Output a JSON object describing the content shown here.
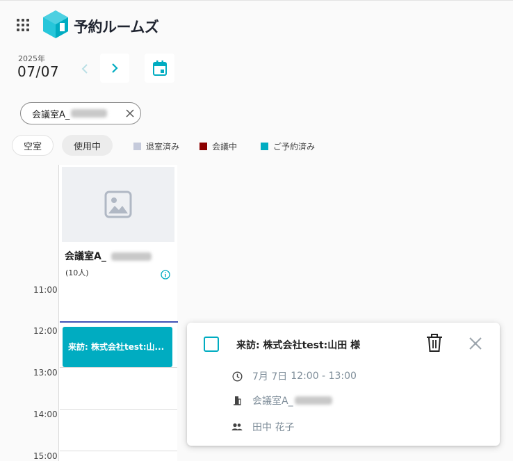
{
  "header": {
    "brand": "予約ルームズ"
  },
  "date": {
    "year": "2025年",
    "day": "07/07"
  },
  "filter": {
    "room_chip": "会議室A_"
  },
  "status_filters": {
    "vacant": "空室",
    "in_use": "使用中"
  },
  "legend": [
    {
      "label": "退室済み",
      "color": "#c5cadb"
    },
    {
      "label": "会議中",
      "color": "#8b0000"
    },
    {
      "label": "ご予約済み",
      "color": "#00acc1"
    }
  ],
  "room": {
    "name": "会議室A_",
    "capacity": "(10人)"
  },
  "times": [
    "11:00",
    "12:00",
    "13:00",
    "14:00",
    "15:00"
  ],
  "event": {
    "label": "来訪: 株式会社test:山..."
  },
  "popup": {
    "title": "来訪: 株式会社test:山田 様",
    "date_prefix": "7月 7日",
    "time_range": "12:00 - 13:00",
    "room": "会議室A_",
    "attendee": "田中 花子"
  },
  "colors": {
    "accent": "#00acc1",
    "now_line": "#3f51b5"
  }
}
